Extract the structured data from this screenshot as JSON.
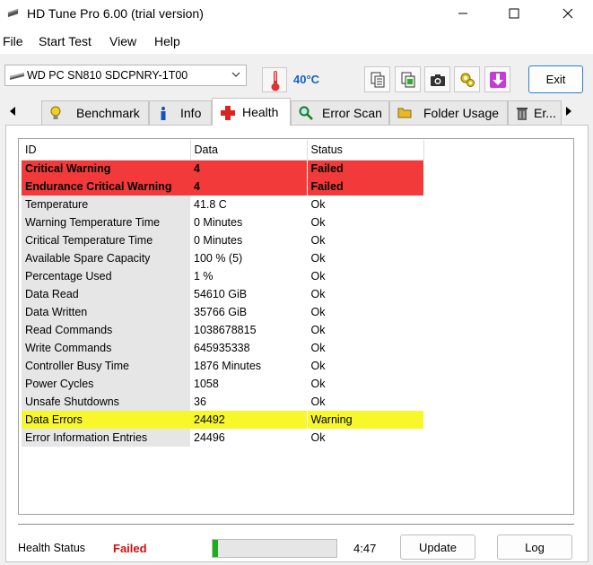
{
  "window": {
    "title": "HD Tune Pro 6.00 (trial version)",
    "minimize_icon": "minimize-icon",
    "maximize_icon": "maximize-icon",
    "close_icon": "close-icon"
  },
  "menu": [
    "File",
    "Start Test",
    "View",
    "Help"
  ],
  "toolbar": {
    "drive": "WD PC SN810 SDCPNRY-1T00",
    "temperature": "40°C",
    "exit_label": "Exit",
    "buttons": [
      "copy-text-icon",
      "copy-info-icon",
      "screenshot-camera-icon",
      "options-gear-icon",
      "save-download-icon"
    ]
  },
  "tabs": [
    {
      "label": "Benchmark",
      "icon": "lightbulb-icon"
    },
    {
      "label": "Info",
      "icon": "info-icon"
    },
    {
      "label": "Health",
      "icon": "health-cross-icon",
      "active": true
    },
    {
      "label": "Error Scan",
      "icon": "magnifier-icon"
    },
    {
      "label": "Folder Usage",
      "icon": "folder-icon"
    },
    {
      "label": "Er...",
      "icon": "trash-icon"
    }
  ],
  "table": {
    "headers": [
      "ID",
      "Data",
      "Status"
    ],
    "rows": [
      {
        "id": "Critical Warning",
        "data": "4",
        "status": "Failed",
        "level": "critical"
      },
      {
        "id": "Endurance Critical Warning",
        "data": "4",
        "status": "Failed",
        "level": "critical"
      },
      {
        "id": "Temperature",
        "data": "41.8 C",
        "status": "Ok",
        "level": "ok"
      },
      {
        "id": "Warning Temperature Time",
        "data": "0 Minutes",
        "status": "Ok",
        "level": "ok"
      },
      {
        "id": "Critical Temperature Time",
        "data": "0 Minutes",
        "status": "Ok",
        "level": "ok"
      },
      {
        "id": "Available Spare Capacity",
        "data": "100 % (5)",
        "status": "Ok",
        "level": "ok"
      },
      {
        "id": "Percentage Used",
        "data": "1 %",
        "status": "Ok",
        "level": "ok"
      },
      {
        "id": "Data Read",
        "data": "54610 GiB",
        "status": "Ok",
        "level": "ok"
      },
      {
        "id": "Data Written",
        "data": "35766 GiB",
        "status": "Ok",
        "level": "ok"
      },
      {
        "id": "Read Commands",
        "data": "1038678815",
        "status": "Ok",
        "level": "ok"
      },
      {
        "id": "Write Commands",
        "data": "645935338",
        "status": "Ok",
        "level": "ok"
      },
      {
        "id": "Controller Busy Time",
        "data": "1876 Minutes",
        "status": "Ok",
        "level": "ok"
      },
      {
        "id": "Power Cycles",
        "data": "1058",
        "status": "Ok",
        "level": "ok"
      },
      {
        "id": "Unsafe Shutdowns",
        "data": "36",
        "status": "Ok",
        "level": "ok"
      },
      {
        "id": "Data Errors",
        "data": "24492",
        "status": "Warning",
        "level": "warning"
      },
      {
        "id": "Error Information Entries",
        "data": "24496",
        "status": "Ok",
        "level": "ok"
      }
    ]
  },
  "footer": {
    "health_label": "Health Status",
    "health_value": "Failed",
    "progress_fraction": 0.04,
    "time": "4:47",
    "update_label": "Update",
    "log_label": "Log"
  },
  "colors": {
    "critical": "#f33a3a",
    "warning": "#f7f72a",
    "failed_text": "#d01010",
    "temperature_text": "#1a5fbf",
    "progress": "#1bb01b"
  }
}
